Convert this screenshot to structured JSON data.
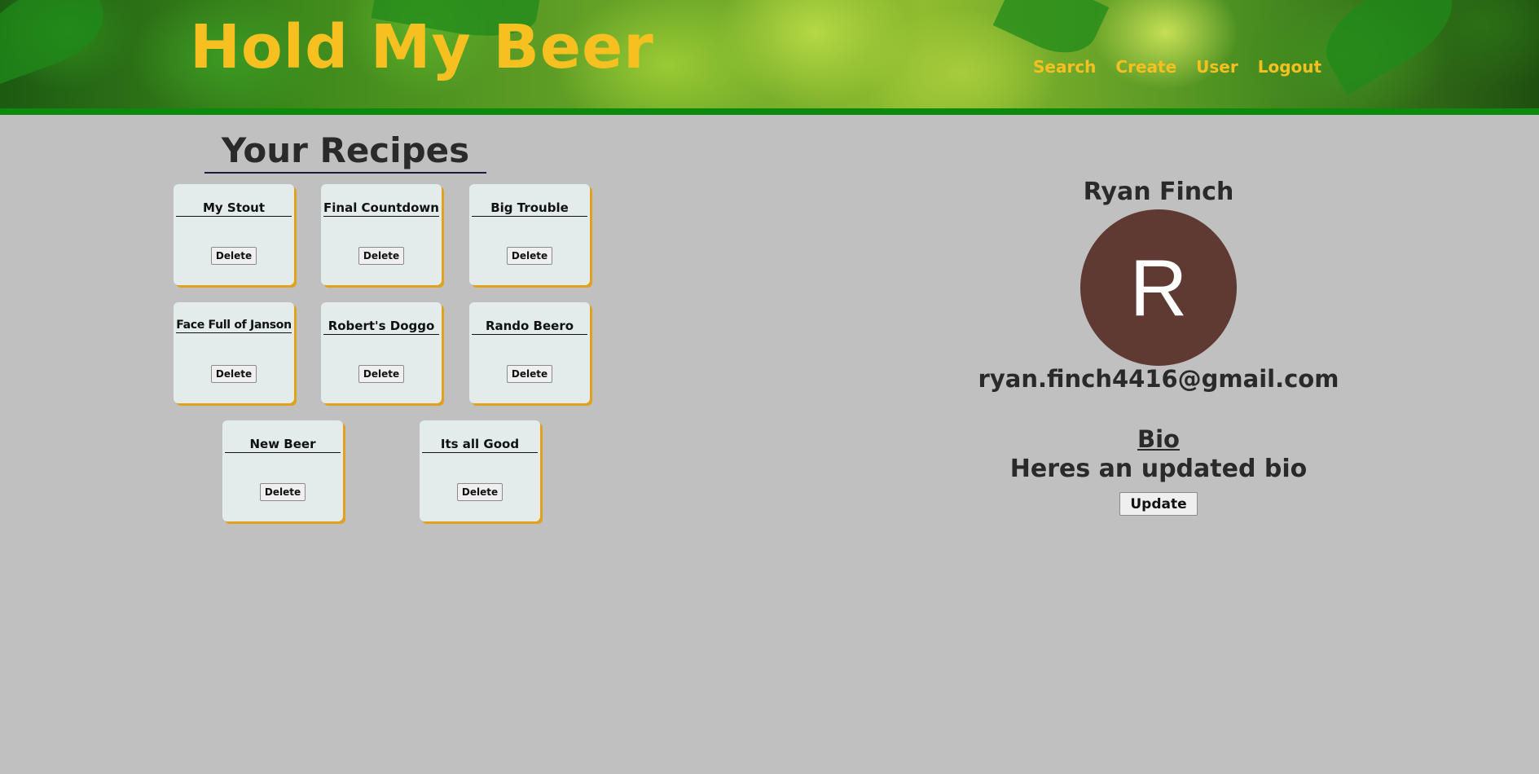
{
  "header": {
    "title": "Hold My Beer",
    "nav": {
      "search": "Search",
      "create": "Create",
      "user": "User",
      "logout": "Logout"
    }
  },
  "recipes": {
    "heading": "Your Recipes",
    "delete_label": "Delete",
    "items": [
      {
        "title": "My Stout"
      },
      {
        "title": "Final Countdown"
      },
      {
        "title": "Big Trouble"
      },
      {
        "title": "Face Full of Janson"
      },
      {
        "title": "Robert's Doggo"
      },
      {
        "title": "Rando Beero"
      },
      {
        "title": "New Beer"
      },
      {
        "title": "Its all Good"
      }
    ]
  },
  "profile": {
    "name": "Ryan Finch",
    "avatar_initial": "R",
    "email": "ryan.finch4416@gmail.com",
    "bio_heading": "Bio",
    "bio_text": "Heres an updated bio",
    "update_label": "Update"
  },
  "colors": {
    "accent_gold": "#f6c021",
    "header_bar_green": "#0c8a0c",
    "avatar_bg": "#5e3a32",
    "page_bg": "#c0c0c0",
    "card_bg": "#e3ecea",
    "card_shadow": "#e0a21c"
  }
}
